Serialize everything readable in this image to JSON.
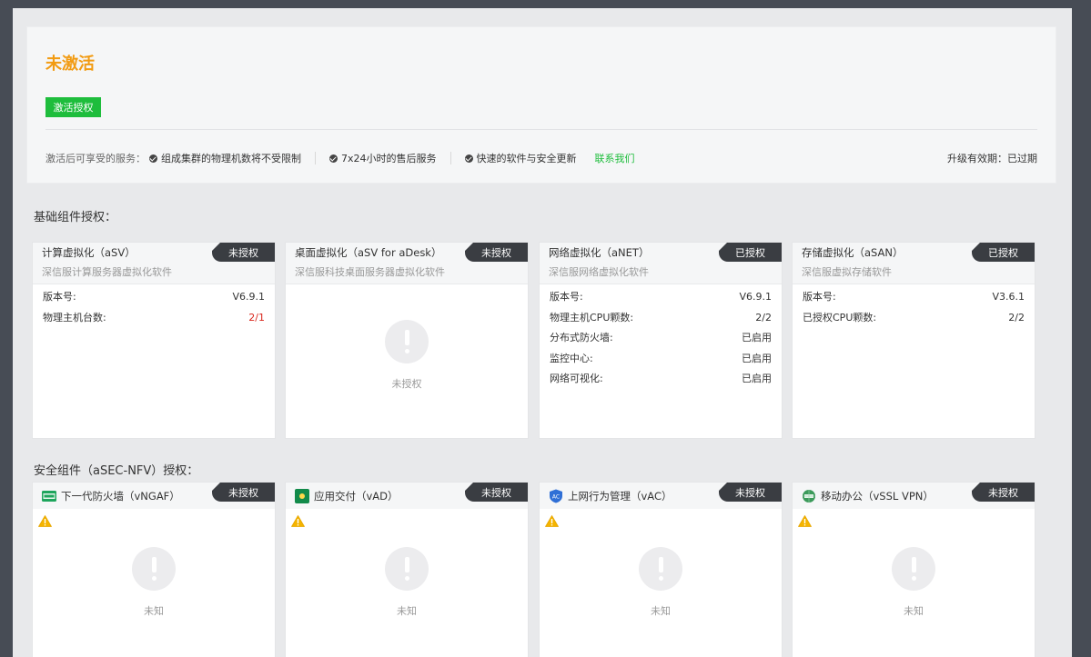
{
  "status": {
    "title": "未激活",
    "activate_label": "激活授权",
    "benefits_label": "激活后可享受的服务：",
    "benefits": [
      "组成集群的物理机数将不受限制",
      "7x24小时的售后服务",
      "快速的软件与安全更新"
    ],
    "contact_label": "联系我们",
    "validity": "升级有效期：已过期"
  },
  "colors": {
    "accent_orange": "#f29b12",
    "accent_green": "#1ebd3c",
    "badge_dark": "#3a3d42",
    "value_red": "#d9261c"
  },
  "basic": {
    "section_title": "基础组件授权：",
    "cards": [
      {
        "name": "计算虚拟化（aSV）",
        "badge": "未授权",
        "subtitle": "深信服计算服务器虚拟化软件",
        "rows": [
          {
            "label": "版本号:",
            "value": "V6.9.1"
          },
          {
            "label": "物理主机台数:",
            "value": "2/1"
          }
        ]
      },
      {
        "name": "桌面虚拟化（aSV for aDesk）",
        "badge": "未授权",
        "subtitle": "深信服科技桌面服务器虚拟化软件",
        "empty_text": "未授权"
      },
      {
        "name": "网络虚拟化（aNET）",
        "badge": "已授权",
        "subtitle": "深信服网络虚拟化软件",
        "rows": [
          {
            "label": "版本号:",
            "value": "V6.9.1"
          },
          {
            "label": "物理主机CPU颗数:",
            "value": "2/2"
          },
          {
            "label": "分布式防火墙:",
            "value": "已启用"
          },
          {
            "label": "监控中心:",
            "value": "已启用"
          },
          {
            "label": "网络可视化:",
            "value": "已启用"
          }
        ]
      },
      {
        "name": "存储虚拟化（aSAN）",
        "badge": "已授权",
        "subtitle": "深信服虚拟存储软件",
        "rows": [
          {
            "label": "版本号:",
            "value": "V3.6.1"
          },
          {
            "label": "已授权CPU颗数:",
            "value": "2/2"
          }
        ]
      }
    ]
  },
  "security": {
    "section_title": "安全组件（aSEC-NFV）授权：",
    "cards": [
      {
        "name": "下一代防火墙（vNGAF）",
        "badge": "未授权",
        "icon": "ngaf-icon",
        "empty_text": "未知"
      },
      {
        "name": "应用交付（vAD）",
        "badge": "未授权",
        "icon": "vad-icon",
        "empty_text": "未知"
      },
      {
        "name": "上网行为管理（vAC）",
        "badge": "未授权",
        "icon": "vac-icon",
        "empty_text": "未知"
      },
      {
        "name": "移动办公（vSSL VPN）",
        "badge": "未授权",
        "icon": "vpn-icon",
        "empty_text": "未知"
      }
    ]
  }
}
